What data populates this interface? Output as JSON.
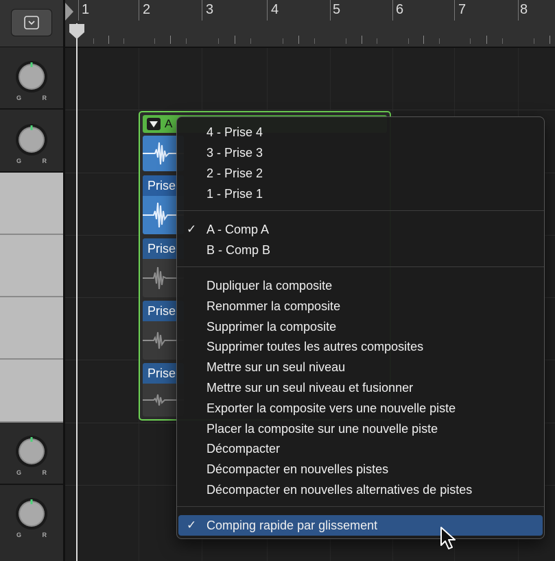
{
  "ruler": {
    "bars": [
      "1",
      "2",
      "3",
      "4",
      "5",
      "6",
      "7",
      "8"
    ]
  },
  "track_headers": {
    "knob_left": "G",
    "knob_right": "R"
  },
  "region": {
    "header_text": "A",
    "takes": [
      "Prise",
      "Prise",
      "Prise",
      "Prise"
    ]
  },
  "menu": {
    "takes": [
      "4 - Prise 4",
      "3 - Prise 3",
      "2 - Prise 2",
      "1 - Prise 1"
    ],
    "comps": [
      {
        "label": "A - Comp A",
        "checked": true
      },
      {
        "label": "B - Comp B",
        "checked": false
      }
    ],
    "actions": [
      "Dupliquer la composite",
      "Renommer la composite",
      "Supprimer la composite",
      "Supprimer toutes les autres composites",
      "Mettre sur un seul niveau",
      "Mettre sur un seul niveau et fusionner",
      "Exporter la composite vers une nouvelle piste",
      "Placer la composite sur une nouvelle piste",
      "Décompacter",
      "Décompacter en nouvelles pistes",
      "Décompacter en nouvelles alternatives de pistes"
    ],
    "quick_swipe": {
      "label": "Comping rapide par glissement",
      "checked": true
    },
    "check_glyph": "✓"
  },
  "colors": {
    "region_border": "#6ed354",
    "region_header": "#58b544",
    "take_active": "#3f7fc4",
    "menu_highlight": "#2d5488",
    "knob_indicator": "#4fd37a"
  }
}
